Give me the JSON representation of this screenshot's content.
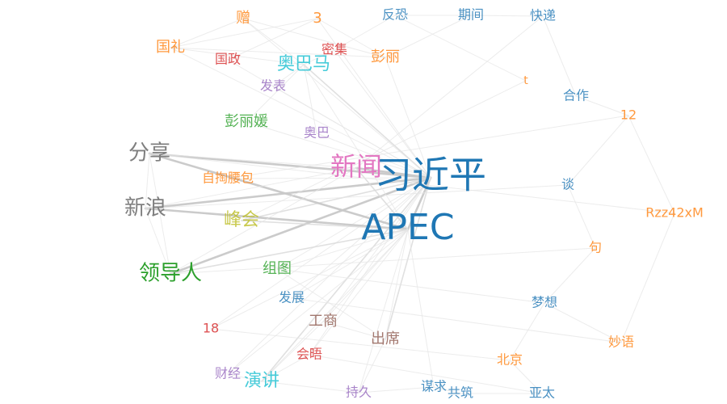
{
  "graph": {
    "nodes": [
      {
        "id": "xijinping",
        "label": "习近平",
        "color": "#1f77b4",
        "weight": 10
      },
      {
        "id": "apec",
        "label": "APEC",
        "color": "#1f77b4",
        "weight": 9
      },
      {
        "id": "xinwen",
        "label": "新闻",
        "color": "#e377c2",
        "weight": 6
      },
      {
        "id": "fenxiang",
        "label": "分享",
        "color": "#7f7f7f",
        "weight": 5
      },
      {
        "id": "xinlang",
        "label": "新浪",
        "color": "#7f7f7f",
        "weight": 5
      },
      {
        "id": "lingdaoren",
        "label": "领导人",
        "color": "#2ca02c",
        "weight": 5
      },
      {
        "id": "fenghui",
        "label": "峰会",
        "color": "#bcbd22",
        "weight": 4
      },
      {
        "id": "aobama",
        "label": "奥巴马",
        "color": "#17becf",
        "weight": 4
      },
      {
        "id": "yanjiang",
        "label": "演讲",
        "color": "#17becf",
        "weight": 4
      },
      {
        "id": "pengliyuan",
        "label": "彭丽媛",
        "color": "#2ca02c",
        "weight": 3
      },
      {
        "id": "chuxi",
        "label": "出席",
        "color": "#8c564b",
        "weight": 3
      },
      {
        "id": "gongshang",
        "label": "工商",
        "color": "#8c564b",
        "weight": 3
      },
      {
        "id": "zutu",
        "label": "组图",
        "color": "#2ca02c",
        "weight": 3
      },
      {
        "id": "guoli",
        "label": "国礼",
        "color": "#ff7f0e",
        "weight": 3
      },
      {
        "id": "pengli",
        "label": "彭丽",
        "color": "#ff7f0e",
        "weight": 3
      },
      {
        "id": "zeng",
        "label": "赠",
        "color": "#ff7f0e",
        "weight": 3
      },
      {
        "id": "three",
        "label": "3",
        "color": "#ff7f0e",
        "weight": 3
      },
      {
        "id": "fazhan",
        "label": "发展",
        "color": "#1f77b4",
        "weight": 2
      },
      {
        "id": "fabiao",
        "label": "发表",
        "color": "#9467bd",
        "weight": 2
      },
      {
        "id": "aoba",
        "label": "奥巴",
        "color": "#9467bd",
        "weight": 2
      },
      {
        "id": "guozheng",
        "label": "国政",
        "color": "#d62728",
        "weight": 2
      },
      {
        "id": "miji",
        "label": "密集",
        "color": "#d62728",
        "weight": 2
      },
      {
        "id": "zitaoyaobao",
        "label": "自掏腰包",
        "color": "#ff7f0e",
        "weight": 2
      },
      {
        "id": "eighteen",
        "label": "18",
        "color": "#d62728",
        "weight": 2
      },
      {
        "id": "huiwu",
        "label": "会晤",
        "color": "#d62728",
        "weight": 2
      },
      {
        "id": "caijing",
        "label": "财经",
        "color": "#9467bd",
        "weight": 2
      },
      {
        "id": "chijiu",
        "label": "持久",
        "color": "#9467bd",
        "weight": 2
      },
      {
        "id": "mouqiu",
        "label": "谋求",
        "color": "#1f77b4",
        "weight": 2
      },
      {
        "id": "gongzhu",
        "label": "共筑",
        "color": "#1f77b4",
        "weight": 2
      },
      {
        "id": "yatai",
        "label": "亚太",
        "color": "#1f77b4",
        "weight": 2
      },
      {
        "id": "beijing",
        "label": "北京",
        "color": "#ff7f0e",
        "weight": 2
      },
      {
        "id": "miaoyu",
        "label": "妙语",
        "color": "#ff7f0e",
        "weight": 2
      },
      {
        "id": "mengxiang",
        "label": "梦想",
        "color": "#1f77b4",
        "weight": 2
      },
      {
        "id": "ju",
        "label": "句",
        "color": "#ff7f0e",
        "weight": 2
      },
      {
        "id": "rzz",
        "label": "Rzz42xM",
        "color": "#ff7f0e",
        "weight": 2
      },
      {
        "id": "tan",
        "label": "谈",
        "color": "#1f77b4",
        "weight": 2
      },
      {
        "id": "twelve",
        "label": "12",
        "color": "#ff7f0e",
        "weight": 2
      },
      {
        "id": "hezuo",
        "label": "合作",
        "color": "#1f77b4",
        "weight": 2
      },
      {
        "id": "t",
        "label": "t",
        "color": "#ff7f0e",
        "weight": 1
      },
      {
        "id": "kuaidi",
        "label": "快递",
        "color": "#1f77b4",
        "weight": 2
      },
      {
        "id": "qijian",
        "label": "期间",
        "color": "#1f77b4",
        "weight": 2
      },
      {
        "id": "fankong",
        "label": "反恐",
        "color": "#1f77b4",
        "weight": 2
      }
    ],
    "edges": [
      [
        "xijinping",
        "apec",
        3
      ],
      [
        "xijinping",
        "xinwen",
        3
      ],
      [
        "xijinping",
        "fenxiang",
        3
      ],
      [
        "xijinping",
        "xinlang",
        3
      ],
      [
        "xijinping",
        "lingdaoren",
        3
      ],
      [
        "xijinping",
        "fenghui",
        2
      ],
      [
        "xijinping",
        "aobama",
        2
      ],
      [
        "xijinping",
        "yanjiang",
        2
      ],
      [
        "xijinping",
        "chuxi",
        2
      ],
      [
        "xijinping",
        "pengliyuan",
        1
      ],
      [
        "xijinping",
        "guoli",
        1
      ],
      [
        "xijinping",
        "zeng",
        1
      ],
      [
        "xijinping",
        "zutu",
        1
      ],
      [
        "xijinping",
        "gongshang",
        1
      ],
      [
        "xijinping",
        "fazhan",
        1
      ],
      [
        "xijinping",
        "huiwu",
        1
      ],
      [
        "xijinping",
        "guozheng",
        1
      ],
      [
        "xijinping",
        "miji",
        1
      ],
      [
        "xijinping",
        "fabiao",
        1
      ],
      [
        "xijinping",
        "aoba",
        1
      ],
      [
        "xijinping",
        "zitaoyaobao",
        1
      ],
      [
        "xijinping",
        "caijing",
        1
      ],
      [
        "xijinping",
        "eighteen",
        1
      ],
      [
        "xijinping",
        "pengli",
        1
      ],
      [
        "xijinping",
        "three",
        1
      ],
      [
        "apec",
        "fenxiang",
        3
      ],
      [
        "apec",
        "xinlang",
        3
      ],
      [
        "apec",
        "lingdaoren",
        2
      ],
      [
        "apec",
        "xinwen",
        2
      ],
      [
        "apec",
        "fenghui",
        2
      ],
      [
        "apec",
        "chuxi",
        1
      ],
      [
        "apec",
        "yanjiang",
        1
      ],
      [
        "apec",
        "gongshang",
        1
      ],
      [
        "apec",
        "zutu",
        1
      ],
      [
        "apec",
        "huiwu",
        1
      ],
      [
        "apec",
        "chijiu",
        1
      ],
      [
        "apec",
        "mouqiu",
        1
      ],
      [
        "apec",
        "aobama",
        1
      ],
      [
        "apec",
        "caijing",
        1
      ],
      [
        "apec",
        "eighteen",
        1
      ],
      [
        "apec",
        "fazhan",
        1
      ],
      [
        "xinwen",
        "fenxiang",
        1
      ],
      [
        "xinwen",
        "xinlang",
        1
      ],
      [
        "xinwen",
        "lingdaoren",
        1
      ],
      [
        "fenxiang",
        "xinlang",
        1
      ],
      [
        "fenxiang",
        "lingdaoren",
        1
      ],
      [
        "xinlang",
        "lingdaoren",
        1
      ],
      [
        "guoli",
        "zeng",
        1
      ],
      [
        "guoli",
        "three",
        1
      ],
      [
        "guoli",
        "pengli",
        1
      ],
      [
        "guoli",
        "aobama",
        1
      ],
      [
        "zeng",
        "pengli",
        1
      ],
      [
        "zeng",
        "aobama",
        1
      ],
      [
        "three",
        "pengli",
        1
      ],
      [
        "three",
        "guozheng",
        1
      ],
      [
        "aobama",
        "fabiao",
        1
      ],
      [
        "aobama",
        "pengliyuan",
        1
      ],
      [
        "aobama",
        "aoba",
        1
      ],
      [
        "aobama",
        "miji",
        1
      ],
      [
        "yanjiang",
        "chijiu",
        1
      ],
      [
        "yanjiang",
        "caijing",
        1
      ],
      [
        "yanjiang",
        "gongshang",
        1
      ],
      [
        "yanjiang",
        "huiwu",
        1
      ],
      [
        "chuxi",
        "gongshang",
        1
      ],
      [
        "chuxi",
        "chijiu",
        1
      ],
      [
        "chuxi",
        "zutu",
        1
      ],
      [
        "fankong",
        "qijian",
        1
      ],
      [
        "qijian",
        "kuaidi",
        1
      ],
      [
        "kuaidi",
        "hezuo",
        1
      ],
      [
        "fankong",
        "t",
        1
      ],
      [
        "hezuo",
        "twelve",
        1
      ],
      [
        "twelve",
        "rzz",
        1
      ],
      [
        "twelve",
        "tan",
        1
      ],
      [
        "tan",
        "ju",
        1
      ],
      [
        "ju",
        "mengxiang",
        1
      ],
      [
        "mengxiang",
        "miaoyu",
        1
      ],
      [
        "mengxiang",
        "beijing",
        1
      ],
      [
        "beijing",
        "yatai",
        1
      ],
      [
        "yatai",
        "gongzhu",
        1
      ],
      [
        "gongzhu",
        "mouqiu",
        1
      ],
      [
        "mouqiu",
        "chijiu",
        1
      ],
      [
        "miaoyu",
        "rzz",
        1
      ],
      [
        "fankong",
        "miji",
        1
      ],
      [
        "qijian",
        "pengli",
        1
      ],
      [
        "kuaidi",
        "xinwen",
        1
      ],
      [
        "t",
        "fenghui",
        1
      ],
      [
        "twelve",
        "zitaoyaobao",
        1
      ],
      [
        "rzz",
        "fenxiang",
        1
      ],
      [
        "tan",
        "xinlang",
        1
      ],
      [
        "ju",
        "lingdaoren",
        1
      ],
      [
        "mengxiang",
        "zutu",
        1
      ],
      [
        "beijing",
        "eighteen",
        1
      ],
      [
        "yatai",
        "huiwu",
        1
      ],
      [
        "miaoyu",
        "fazhan",
        1
      ]
    ]
  }
}
